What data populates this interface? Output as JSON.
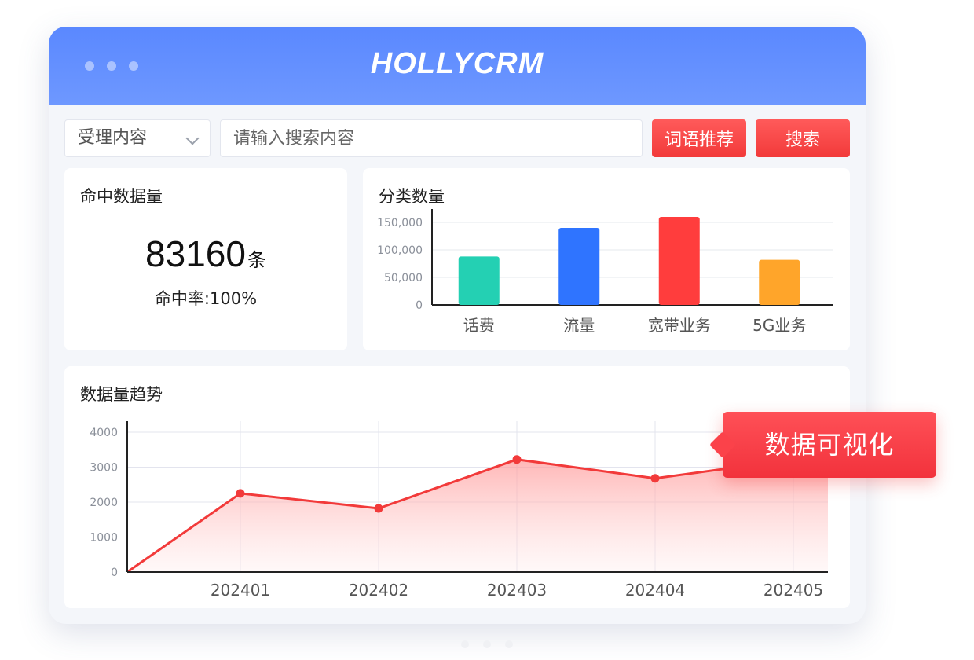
{
  "window": {
    "brand": "HOLLYCRM"
  },
  "toolbar": {
    "select_value": "受理内容",
    "search_placeholder": "请输入搜索内容",
    "recommend_label": "词语推荐",
    "search_label": "搜索"
  },
  "hit_card": {
    "title": "命中数据量",
    "count": "83160",
    "unit": "条",
    "rate": "命中率:100%"
  },
  "category_card": {
    "title": "分类数量"
  },
  "trend_card": {
    "title": "数据量趋势"
  },
  "badge": {
    "label": "数据可视化"
  },
  "colors": {
    "accent_blue": "#5a88ff",
    "button_red": "#f23a3a",
    "line_red": "#f23a3a"
  },
  "chart_data": [
    {
      "type": "bar",
      "categories": [
        "话费",
        "流量",
        "宽带业务",
        "5G业务"
      ],
      "values": [
        88000,
        140000,
        160000,
        82000
      ],
      "colors": [
        "#24d0b3",
        "#2f74ff",
        "#ff3d3d",
        "#ffa52a"
      ],
      "ylim": [
        0,
        160000
      ],
      "yticks": [
        "0",
        "50,000",
        "100,000",
        "150,000"
      ],
      "ytick_values": [
        0,
        50000,
        100000,
        150000
      ],
      "grid": true
    },
    {
      "type": "area",
      "x": [
        "202401",
        "202402",
        "202403",
        "202404",
        "202405"
      ],
      "values": [
        2250,
        1820,
        3220,
        2680,
        3220
      ],
      "origin_value": 0,
      "ylim": [
        0,
        4000
      ],
      "yticks": [
        "0",
        "1000",
        "2000",
        "3000",
        "4000"
      ],
      "ytick_values": [
        0,
        1000,
        2000,
        3000,
        4000
      ],
      "grid": true
    }
  ]
}
